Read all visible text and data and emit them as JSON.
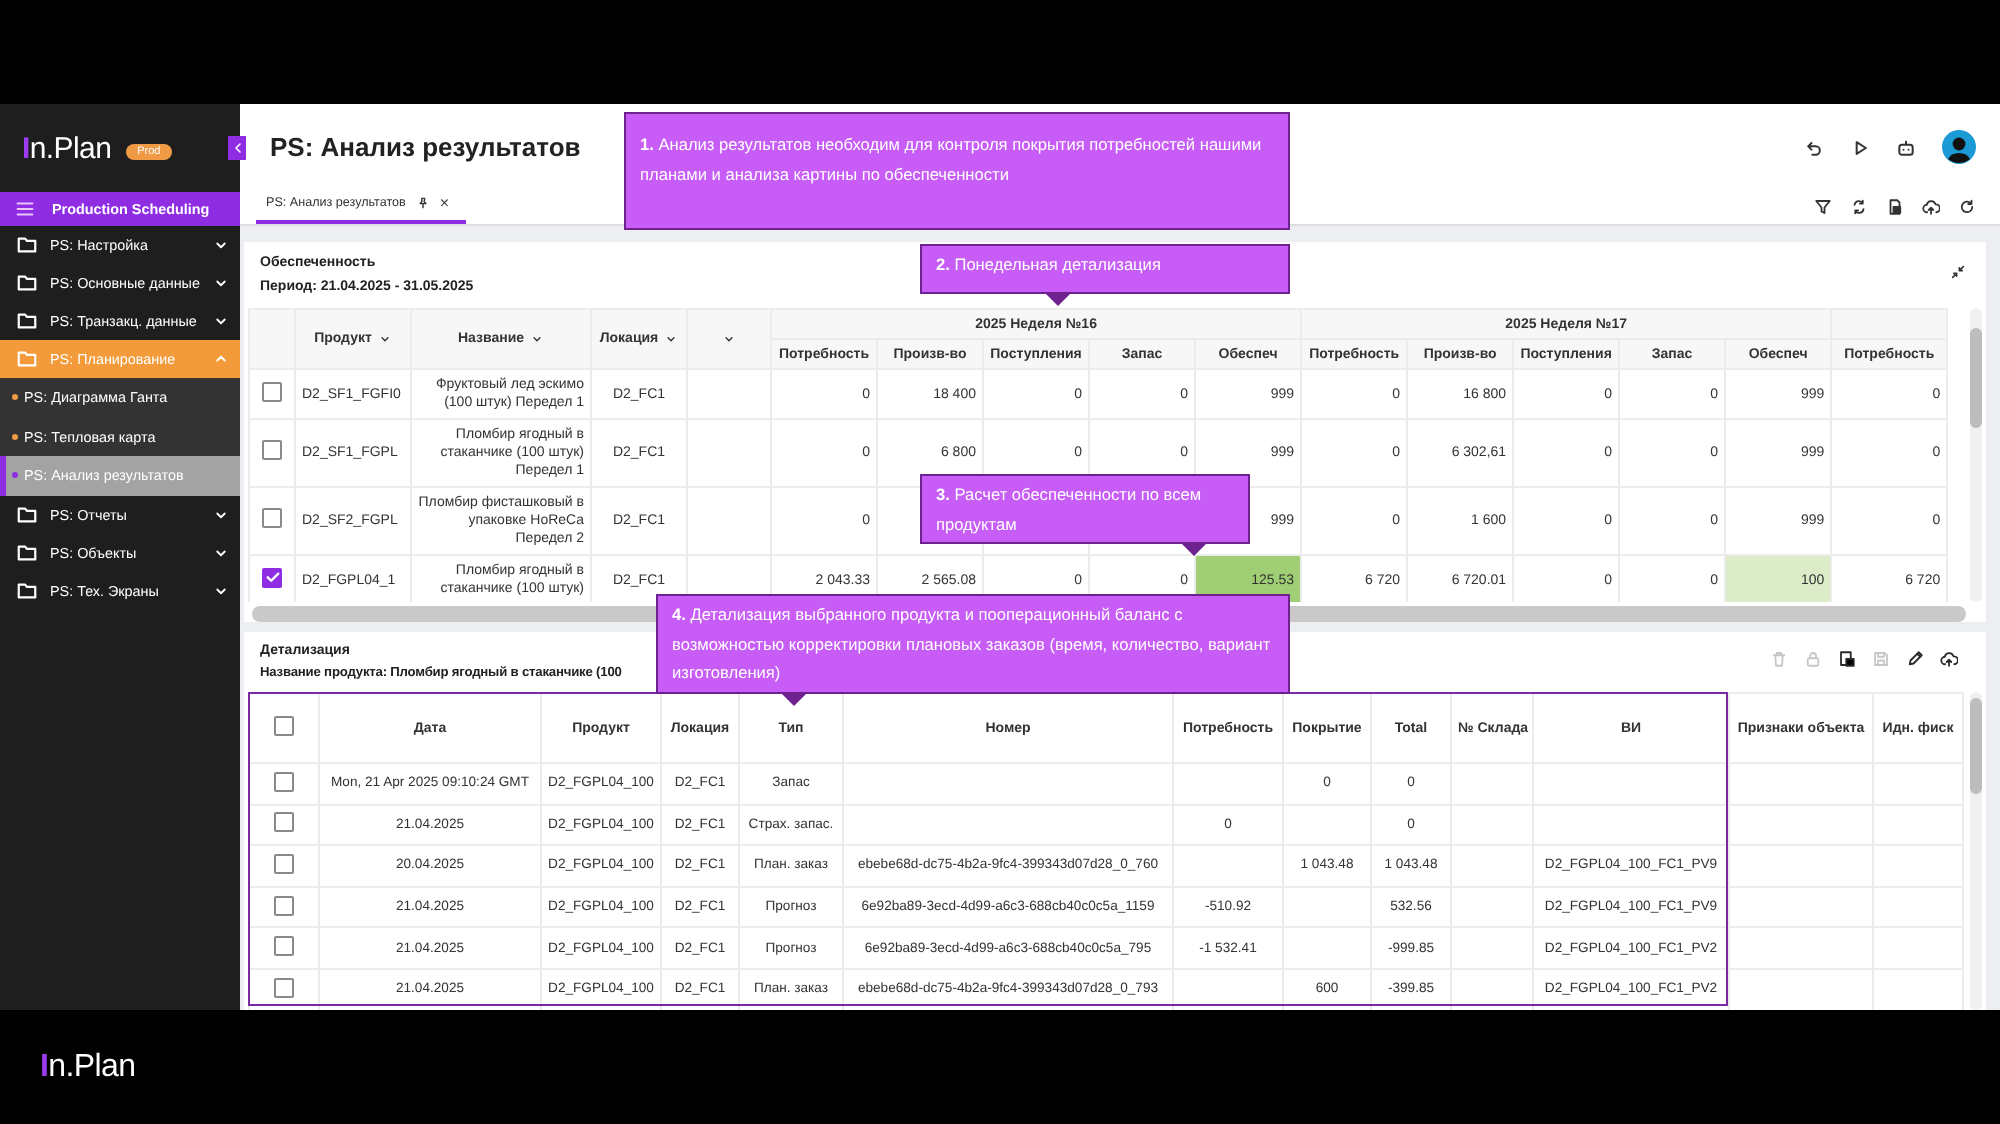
{
  "sidebar": {
    "logo": "In.Plan",
    "badge": "Prod",
    "module": "Production Scheduling",
    "items": [
      {
        "label": "PS: Настройка",
        "expanded": false
      },
      {
        "label": "PS: Основные данные",
        "expanded": false
      },
      {
        "label": "PS: Транзакц. данные",
        "expanded": false
      },
      {
        "label": "PS: Планирование",
        "expanded": true,
        "children": [
          {
            "label": "PS: Диаграмма Ганта",
            "selected": false
          },
          {
            "label": "PS: Тепловая карта",
            "selected": false
          },
          {
            "label": "PS: Анализ результатов",
            "selected": true
          }
        ]
      },
      {
        "label": "PS: Отчеты",
        "expanded": false
      },
      {
        "label": "PS: Объекты",
        "expanded": false
      },
      {
        "label": "PS: Тех. Экраны",
        "expanded": false
      }
    ]
  },
  "header": {
    "title": "PS: Анализ результатов",
    "tabs": [
      {
        "label": "PS: Анализ результатов",
        "selected": true,
        "close": "×"
      }
    ]
  },
  "coverage": {
    "title": "Обеспеченность",
    "period": "Период: 21.04.2025 - 31.05.2025",
    "columns": [
      "Продукт",
      "Название",
      "Локация"
    ],
    "weeks": [
      {
        "label": "2025 Неделя №16",
        "columns": [
          "Потребность",
          "Произв-во",
          "Поступления",
          "Запас",
          "Обеспеч"
        ]
      },
      {
        "label": "2025 Неделя №17",
        "columns": [
          "Потребность",
          "Произв-во",
          "Поступления",
          "Запас",
          "Обеспеч"
        ]
      },
      {
        "columns": [
          "Потребность"
        ]
      }
    ],
    "rows": [
      {
        "selected": false,
        "product": "D2_SF1_FGFI0",
        "name": "Фруктовый лед эскимо (100 штук) Передел 1",
        "location": "D2_FC1",
        "weeks": [
          {
            "demand": "0",
            "production": "18 400",
            "receipts": "0",
            "stock": "0",
            "coverage": "999"
          },
          {
            "demand": "0",
            "production": "16 800",
            "receipts": "0",
            "stock": "0",
            "coverage": "999"
          },
          {
            "demand": "0"
          }
        ]
      },
      {
        "selected": false,
        "product": "D2_SF1_FGPL",
        "name": "Пломбир ягодный в стаканчике (100 штук) Передел 1",
        "location": "D2_FC1",
        "weeks": [
          {
            "demand": "0",
            "production": "6 800",
            "receipts": "0",
            "stock": "0",
            "coverage": "999"
          },
          {
            "demand": "0",
            "production": "6 302,61",
            "receipts": "0",
            "stock": "0",
            "coverage": "999"
          },
          {
            "demand": "0"
          }
        ]
      },
      {
        "selected": false,
        "product": "D2_SF2_FGPL",
        "name": "Пломбир фисташковый в упаковке HoReCa Передел 2",
        "location": "D2_FC1",
        "weeks": [
          {
            "demand": "0",
            "coverage": "999"
          },
          {
            "demand": "0",
            "production": "1 600",
            "receipts": "0",
            "stock": "0",
            "coverage": "999"
          },
          {
            "demand": "0"
          }
        ]
      },
      {
        "selected": true,
        "product": "D2_FGPL04_1",
        "name": "Пломбир ягодный в стаканчике (100 штук)",
        "location": "D2_FC1",
        "weeks": [
          {
            "demand": "2 043.33",
            "production": "2 565.08",
            "receipts": "0",
            "stock": "0",
            "coverage": "125.53",
            "color": "#9fce74"
          },
          {
            "demand": "6 720",
            "production": "6 720.01",
            "receipts": "0",
            "stock": "0",
            "coverage": "100",
            "color": "#dcecc9"
          },
          {
            "demand": "6 720"
          }
        ]
      }
    ]
  },
  "detail": {
    "title": "Детализация",
    "product_name": "Название продукта: Пломбир ягодный в стаканчике (100",
    "tools": [
      {
        "kind": "trash",
        "disabled": true
      },
      {
        "kind": "lock",
        "disabled": true
      },
      {
        "kind": "calc",
        "disabled": false
      },
      {
        "kind": "save",
        "disabled": true
      },
      {
        "kind": "pencil",
        "disabled": false
      },
      {
        "kind": "upload",
        "disabled": false
      }
    ],
    "select_all": false,
    "columns": [
      "Дата",
      "Продукт",
      "Локация",
      "Тип",
      "Номер",
      "Потребность",
      "Покрытие",
      "Total",
      "№ Склада",
      "ВИ",
      "Признаки объекта",
      "Идн. фиск"
    ],
    "rows": [
      {
        "checked": false,
        "date": "Mon, 21 Apr 2025 09:10:24 GMT",
        "product": "D2_FGPL04_100",
        "location": "D2_FC1",
        "type": "Запас",
        "cover": "0",
        "total": "0"
      },
      {
        "checked": false,
        "date": "21.04.2025",
        "product": "D2_FGPL04_100",
        "location": "D2_FC1",
        "type": "Страх. запас.",
        "demand": "0",
        "total": "0"
      },
      {
        "checked": false,
        "date": "20.04.2025",
        "product": "D2_FGPL04_100",
        "location": "D2_FC1",
        "type": "План. заказ",
        "number": "ebebe68d-dc75-4b2a-9fc4-399343d07d28_0_760",
        "cover": "1 043.48",
        "total": "1 043.48",
        "vi": "D2_FGPL04_100_FC1_PV9"
      },
      {
        "checked": false,
        "date": "21.04.2025",
        "product": "D2_FGPL04_100",
        "location": "D2_FC1",
        "type": "Прогноз",
        "number": "6e92ba89-3ecd-4d99-a6c3-688cb40c0c5a_1159",
        "demand": "-510.92",
        "total": "532.56",
        "vi": "D2_FGPL04_100_FC1_PV9"
      },
      {
        "checked": false,
        "date": "21.04.2025",
        "product": "D2_FGPL04_100",
        "location": "D2_FC1",
        "type": "Прогноз",
        "number": "6e92ba89-3ecd-4d99-a6c3-688cb40c0c5a_795",
        "demand": "-1 532.41",
        "total": "-999.85",
        "vi": "D2_FGPL04_100_FC1_PV2"
      },
      {
        "checked": false,
        "date": "21.04.2025",
        "product": "D2_FGPL04_100",
        "location": "D2_FC1",
        "type": "План. заказ",
        "number": "ebebe68d-dc75-4b2a-9fc4-399343d07d28_0_793",
        "cover": "600",
        "total": "-399.85",
        "vi": "D2_FGPL04_100_FC1_PV2"
      }
    ]
  },
  "callouts": [
    {
      "text": "**1.** Анализ результатов необходим для контроля покрытия потребностей нашими планами и анализа картины по обеспеченности"
    },
    {
      "text": "**2.** Понедельная детализация"
    },
    {
      "text": "**3.** Расчет обеспеченности по всем продуктам"
    },
    {
      "text": "**4.** Детализация выбранного продукта и пооперационный баланс с возможностью корректировки плановых заказов (время, количество, вариант изготовления)"
    }
  ],
  "footer": {
    "logo": "In.Plan"
  }
}
